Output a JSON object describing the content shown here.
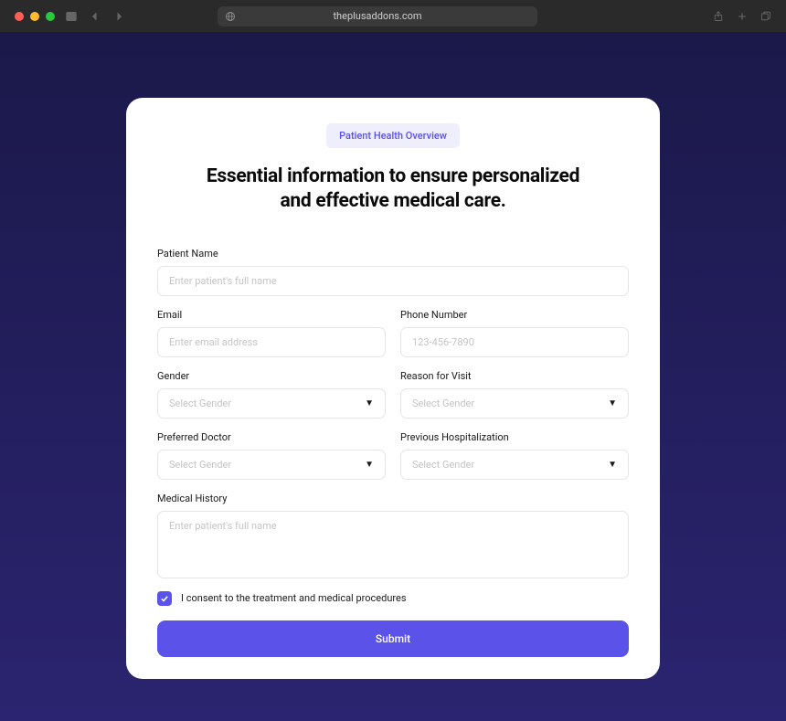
{
  "browser": {
    "url": "theplusaddons.com"
  },
  "form": {
    "badge": "Patient Health Overview",
    "headline_line1": "Essential information to ensure personalized",
    "headline_line2": "and effective medical care.",
    "fields": {
      "patient_name": {
        "label": "Patient Name",
        "placeholder": "Enter patient's full name"
      },
      "email": {
        "label": "Email",
        "placeholder": "Enter email address"
      },
      "phone": {
        "label": "Phone Number",
        "placeholder": "123-456-7890"
      },
      "gender": {
        "label": "Gender",
        "placeholder": "Select Gender"
      },
      "reason": {
        "label": "Reason for Visit",
        "placeholder": "Select Gender"
      },
      "doctor": {
        "label": "Preferred Doctor",
        "placeholder": "Select Gender"
      },
      "hospitalization": {
        "label": "Previous Hospitalization",
        "placeholder": "Select Gender"
      },
      "history": {
        "label": "Medical History",
        "placeholder": "Enter patient's full name"
      }
    },
    "consent": {
      "checked": true,
      "text": "I consent to the treatment and medical procedures"
    },
    "submit_label": "Submit"
  }
}
